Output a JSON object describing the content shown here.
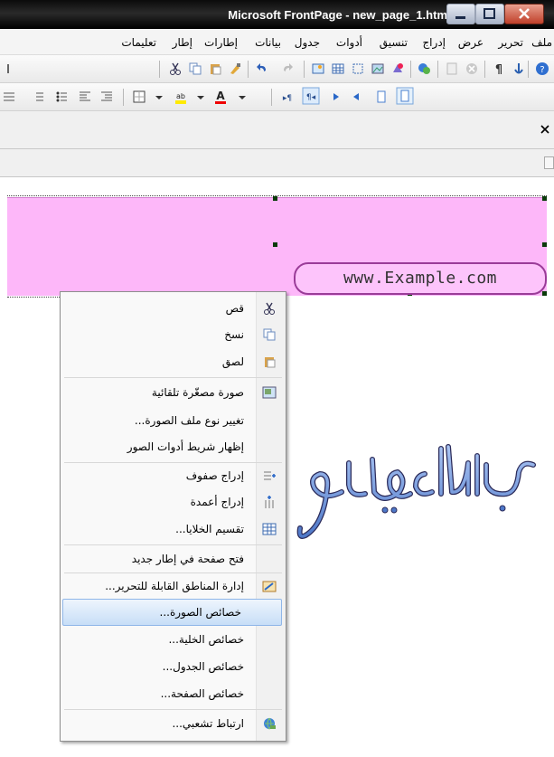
{
  "window": {
    "title": "Microsoft FrontPage - new_page_1.htm"
  },
  "menu": [
    "ملف",
    "تحرير",
    "عرض",
    "إدراج",
    "تنسيق",
    "أدوات",
    "جدول",
    "بيانات",
    "إطارات",
    "إطار",
    "تعليمات"
  ],
  "toolbar_icons": [
    "help-icon",
    "hyperlink-icon",
    "show-all-icon",
    "stop-icon",
    "refresh-icon",
    "web-component-icon",
    "picture-icon",
    "drawing-icon",
    "layer-icon",
    "table-icon",
    "insert-icon",
    "redo-icon",
    "undo-icon",
    "format-painter-icon",
    "paste-icon",
    "copy-icon",
    "cut-icon"
  ],
  "format_icons": [
    "ltr-icon",
    "rtl-icon",
    "align-right-icon",
    "align-left-icon",
    "para-ltr-icon",
    "para-rtl-icon",
    "font-color-icon",
    "highlight-icon",
    "borders-icon",
    "indent-icon",
    "outdent-icon",
    "bullets-icon",
    "numbering-icon"
  ],
  "page": {
    "url_text": "www.Example.com",
    "signature": "عبدالله العجيلي",
    "cell_color": "#fdb7f9"
  },
  "context_menu": {
    "items": [
      {
        "label": "قص",
        "icon": "cut-icon"
      },
      {
        "label": "نسخ",
        "icon": "copy-icon"
      },
      {
        "label": "لصق",
        "icon": "paste-icon"
      },
      {
        "label": "صورة مصغّرة تلقائية",
        "icon": "thumbnail-icon"
      },
      {
        "label": "تغيير نوع ملف الصورة...",
        "icon": ""
      },
      {
        "label": "إظهار شريط أدوات الصور",
        "icon": ""
      },
      {
        "label": "إدراج صفوف",
        "icon": "insert-rows-icon"
      },
      {
        "label": "إدراج أعمدة",
        "icon": "insert-columns-icon"
      },
      {
        "label": "تقسيم الخلايا...",
        "icon": "split-cells-icon"
      },
      {
        "label": "فتح صفحة في إطار جديد",
        "icon": ""
      },
      {
        "label": "إدارة المناطق القابلة للتحرير...",
        "icon": "editable-regions-icon"
      },
      {
        "label": "خصائص الصورة...",
        "icon": ""
      },
      {
        "label": "خصائص الخلية...",
        "icon": ""
      },
      {
        "label": "خصائص الجدول...",
        "icon": ""
      },
      {
        "label": "خصائص الصفحة...",
        "icon": ""
      },
      {
        "label": "ارتباط تشعبي...",
        "icon": "hyperlink-globe-icon"
      }
    ],
    "highlighted": "خصائص الصورة..."
  }
}
